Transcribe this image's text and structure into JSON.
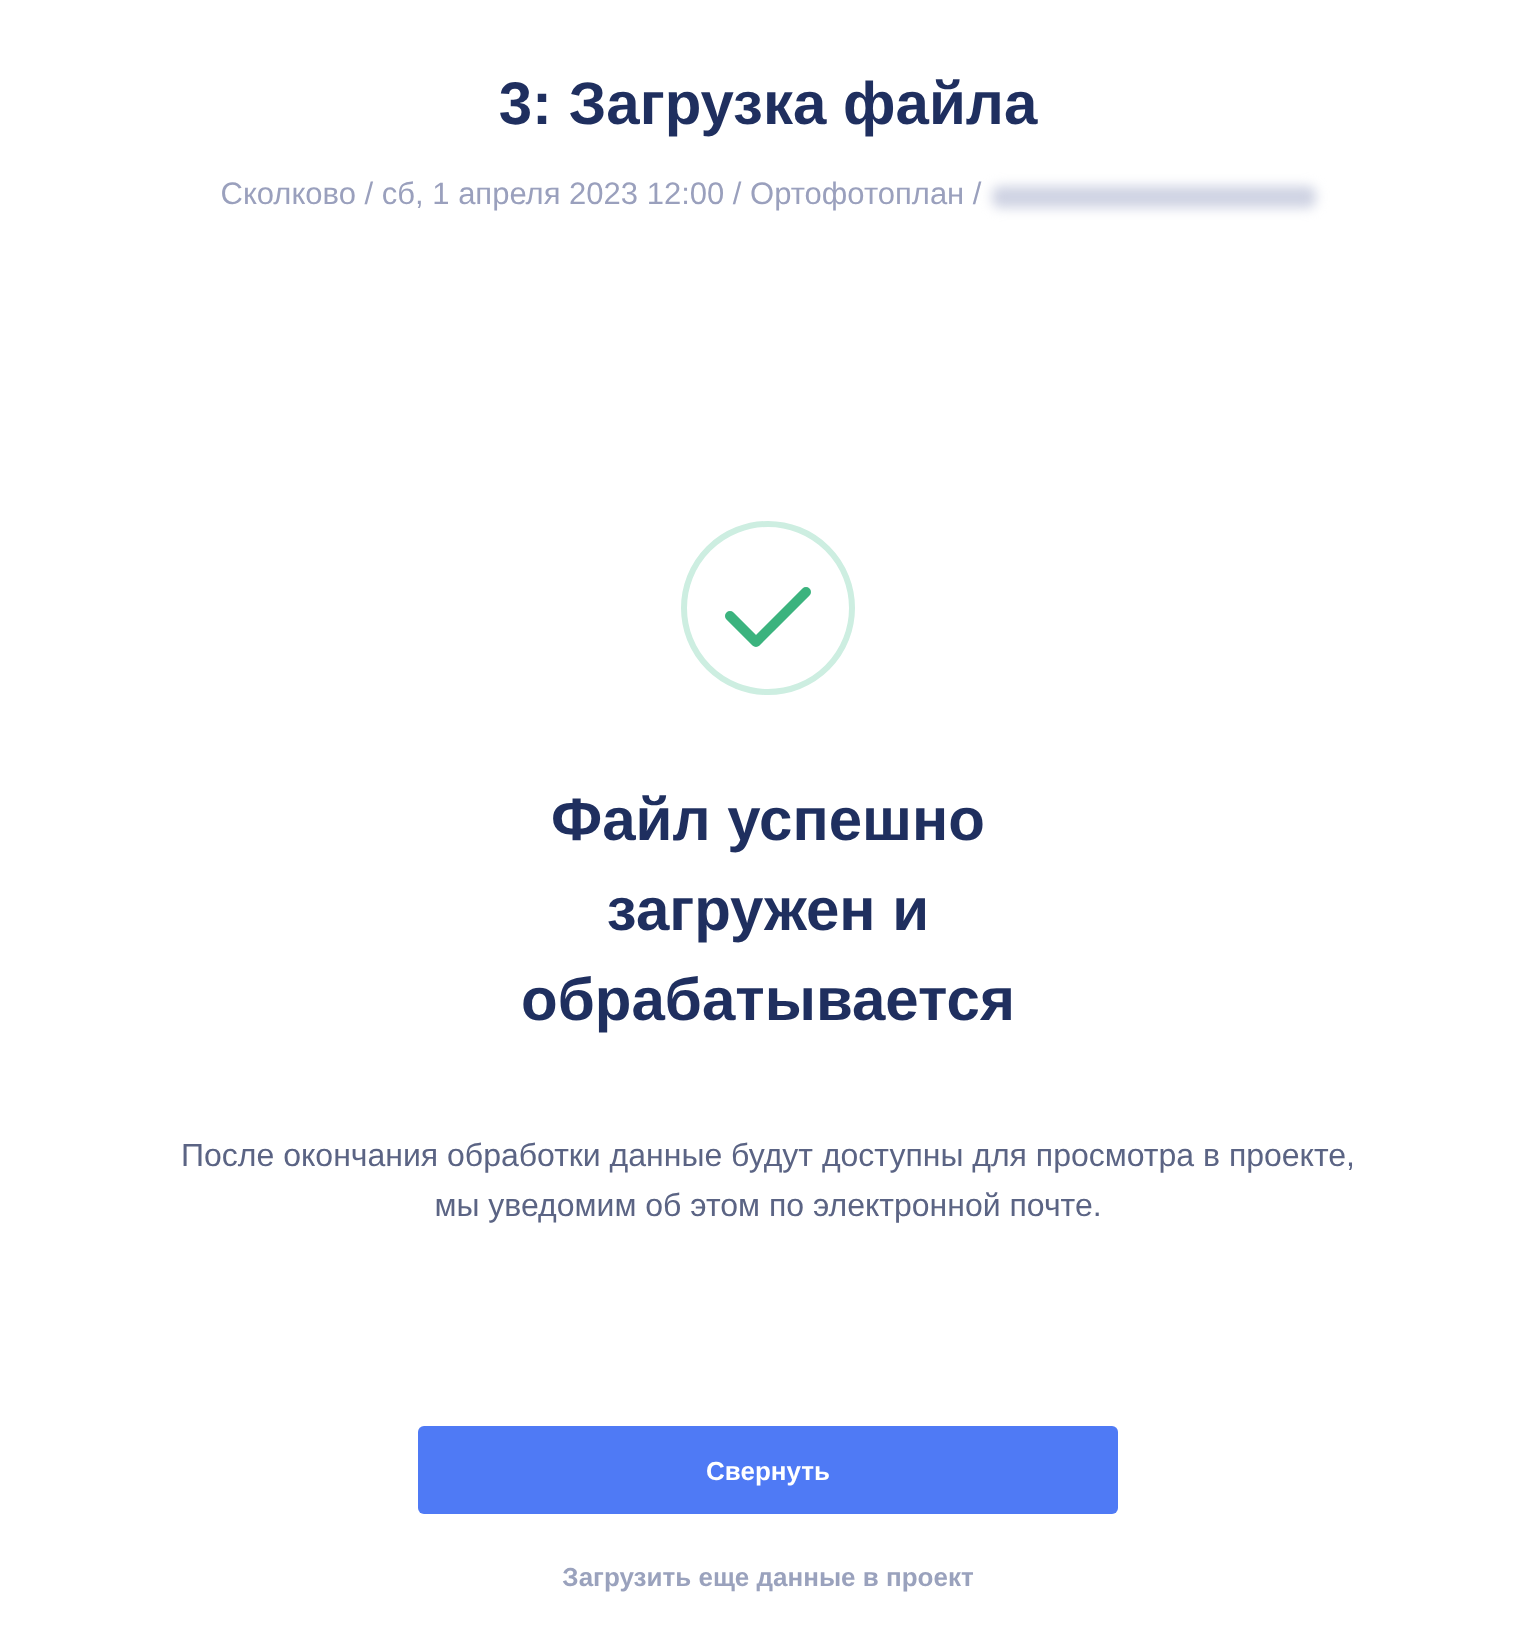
{
  "header": {
    "title": "3: Загрузка файла",
    "breadcrumb": "Сколково / сб, 1 апреля 2023 12:00 / Ортофотоплан /",
    "redacted_tail": true
  },
  "result": {
    "kind": "success",
    "heading": "Файл успешно загружен и обрабатывается",
    "message": "После окончания обработки данные будут доступны для просмотра в проекте, мы уведомим об этом по электронной почте."
  },
  "actions": {
    "primary_button": "Свернуть",
    "link": "Загрузить еще данные в проект"
  }
}
